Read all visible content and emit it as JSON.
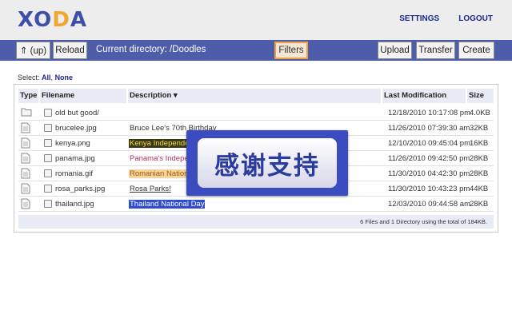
{
  "header": {
    "logo": {
      "x": "X",
      "o": "O",
      "d": "D",
      "a": "A"
    },
    "links": {
      "settings": "SETTINGS",
      "logout": "LOGOUT"
    }
  },
  "toolbar": {
    "up": "⇑ (up)",
    "reload": "Reload",
    "current_directory": "Current directory: /Doodles",
    "filters": "Filters",
    "upload": "Upload",
    "transfer": "Transfer",
    "create": "Create"
  },
  "select": {
    "label": "Select:",
    "all": "All",
    "none": "None"
  },
  "table": {
    "headers": {
      "type": "Type",
      "filename": "Filename",
      "description": "Description ▾",
      "modified": "Last Modification",
      "size": "Size"
    },
    "rows": [
      {
        "type": "folder",
        "name": "old but good/",
        "description": "",
        "date": "12/18/2010 10:17:08 pm",
        "size": "4.0KB"
      },
      {
        "type": "file",
        "name": "brucelee.jpg",
        "description": "Bruce Lee's 70th Birthday",
        "date": "11/26/2010 07:39:30 am",
        "size": "32KB"
      },
      {
        "type": "file",
        "name": "kenya.png",
        "description": "Kenya Independen",
        "date": "12/10/2010 09:45:04 pm",
        "size": "16KB"
      },
      {
        "type": "file",
        "name": "panama.jpg",
        "description": "Panama's Indeper",
        "date": "11/26/2010 09:42:50 pm",
        "size": "28KB"
      },
      {
        "type": "file",
        "name": "romania.gif",
        "description": "Romanian Nationa",
        "date": "11/30/2010 04:42:30 pm",
        "size": "28KB"
      },
      {
        "type": "file",
        "name": "rosa_parks.jpg",
        "description": "Rosa Parks!",
        "date": "11/30/2010 10:43:23 pm",
        "size": "44KB"
      },
      {
        "type": "file",
        "name": "thailand.jpg",
        "description": "Thailand National Day",
        "date": "12/03/2010 09:44:58 am",
        "size": "28KB"
      }
    ],
    "footer": "6 Files and 1 Directory using the total of 184KB."
  },
  "colors": {
    "kenya_bg": "#3a3a1a",
    "kenya_fg": "#ffd940",
    "panama_fg": "#b0305a",
    "romania_bg": "#f9d49a",
    "romania_fg": "#9a5a10",
    "rosa_fg": "#333333",
    "thailand_bg": "#2f4bd0",
    "thailand_fg": "#ffffff"
  },
  "overlay": {
    "text": "感谢支持"
  }
}
